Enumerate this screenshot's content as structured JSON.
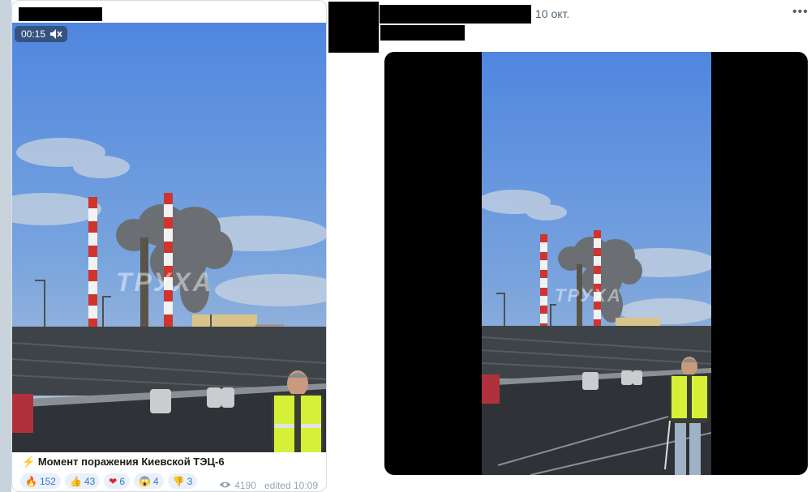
{
  "telegram_post": {
    "video": {
      "duration": "00:15",
      "muted_icon": "speaker-muted-icon",
      "watermark": "ТРУХА"
    },
    "caption_icon": "⚡",
    "caption": "Момент поражения Киевской ТЭЦ-6",
    "reactions": [
      {
        "emoji": "🔥",
        "count": "152"
      },
      {
        "emoji": "👍",
        "count": "43"
      },
      {
        "emoji": "❤",
        "count": "6"
      },
      {
        "emoji": "😱",
        "count": "4"
      },
      {
        "emoji": "👎",
        "count": "3"
      }
    ],
    "views_icon": "eye-icon",
    "views": "4190",
    "edited": "edited 10:09"
  },
  "tweet": {
    "date": "10 окт.",
    "more_icon": "more-icon",
    "more": "•••",
    "video": {
      "watermark": "ТРУХА"
    }
  },
  "colors": {
    "sky": "#5b8fe0",
    "reaction_bg": "#e8f1fb",
    "reaction_text": "#3a7bbf",
    "vest": "#d6f03a"
  }
}
